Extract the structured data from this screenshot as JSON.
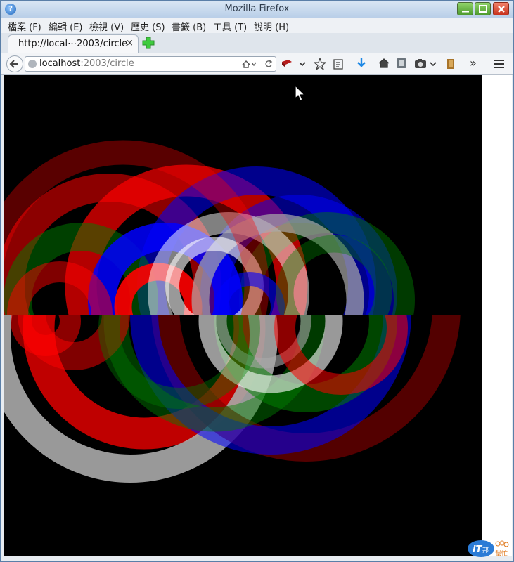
{
  "window": {
    "title": "Mozilla Firefox"
  },
  "menu": [
    "檔案 (F)",
    "編輯 (E)",
    "檢視 (V)",
    "歷史 (S)",
    "書籤 (B)",
    "工具 (T)",
    "說明 (H)"
  ],
  "tab": {
    "label": "http://local⋯2003/circle",
    "close": "×"
  },
  "address": {
    "host": "localhost",
    "rest": ":2003/circle"
  },
  "toolbar": {
    "overflow": "»"
  },
  "icons": [
    "app-icon",
    "minimize-icon",
    "maximize-icon",
    "close-icon",
    "new-tab-icon",
    "back-arrow-icon",
    "site-identity-icon",
    "reload-icon",
    "pocket-icon",
    "dropdown-icon",
    "bookmark-star-icon",
    "reading-list-icon",
    "download-icon",
    "home-icon",
    "screenshot-icon",
    "camera-icon",
    "addon-icon",
    "menu-icon"
  ],
  "canvas": {
    "background": "#000000",
    "palette": {
      "red": "#ff0000",
      "green": "#008000",
      "blue": "#0000ff",
      "white": "#ffffff",
      "grey": "#aaaaaa",
      "darkred": "#800000"
    }
  },
  "watermark": {
    "text": "iT邦幫忙"
  }
}
